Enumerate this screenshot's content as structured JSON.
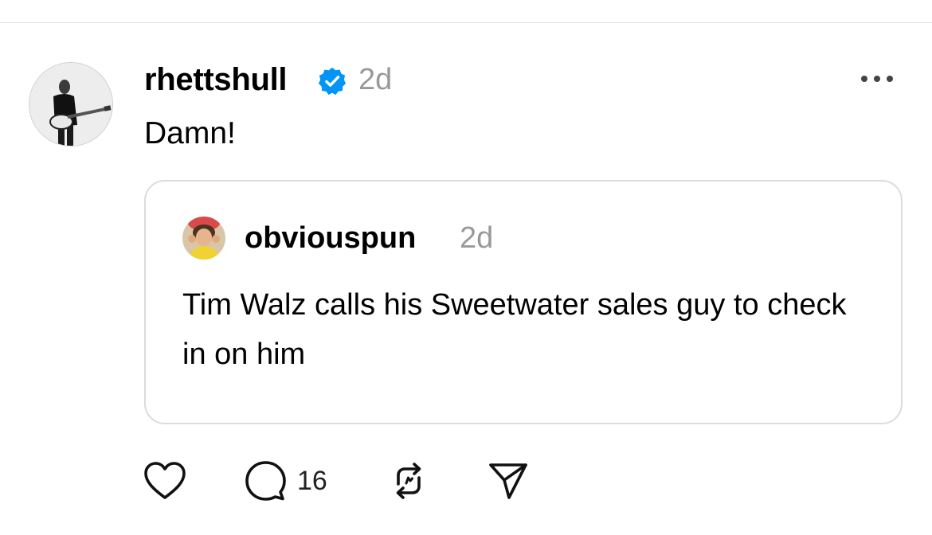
{
  "post": {
    "username": "rhettshull",
    "timestamp": "2d",
    "verified": true,
    "text": "Damn!",
    "avatar_icon": "guitarist-photo",
    "more_icon": "more-horizontal-icon"
  },
  "quoted_post": {
    "username": "obviouspun",
    "timestamp": "2d",
    "text": "Tim Walz calls his Sweetwater sales guy to check in on him",
    "avatar_icon": "person-photo"
  },
  "actions": {
    "like_icon": "heart-icon",
    "reply_icon": "comment-icon",
    "reply_count": "16",
    "repost_icon": "repost-icon",
    "share_icon": "send-icon"
  },
  "colors": {
    "verified_badge": "#0095f6",
    "timestamp": "#999999",
    "card_border": "#dcdcdc"
  }
}
